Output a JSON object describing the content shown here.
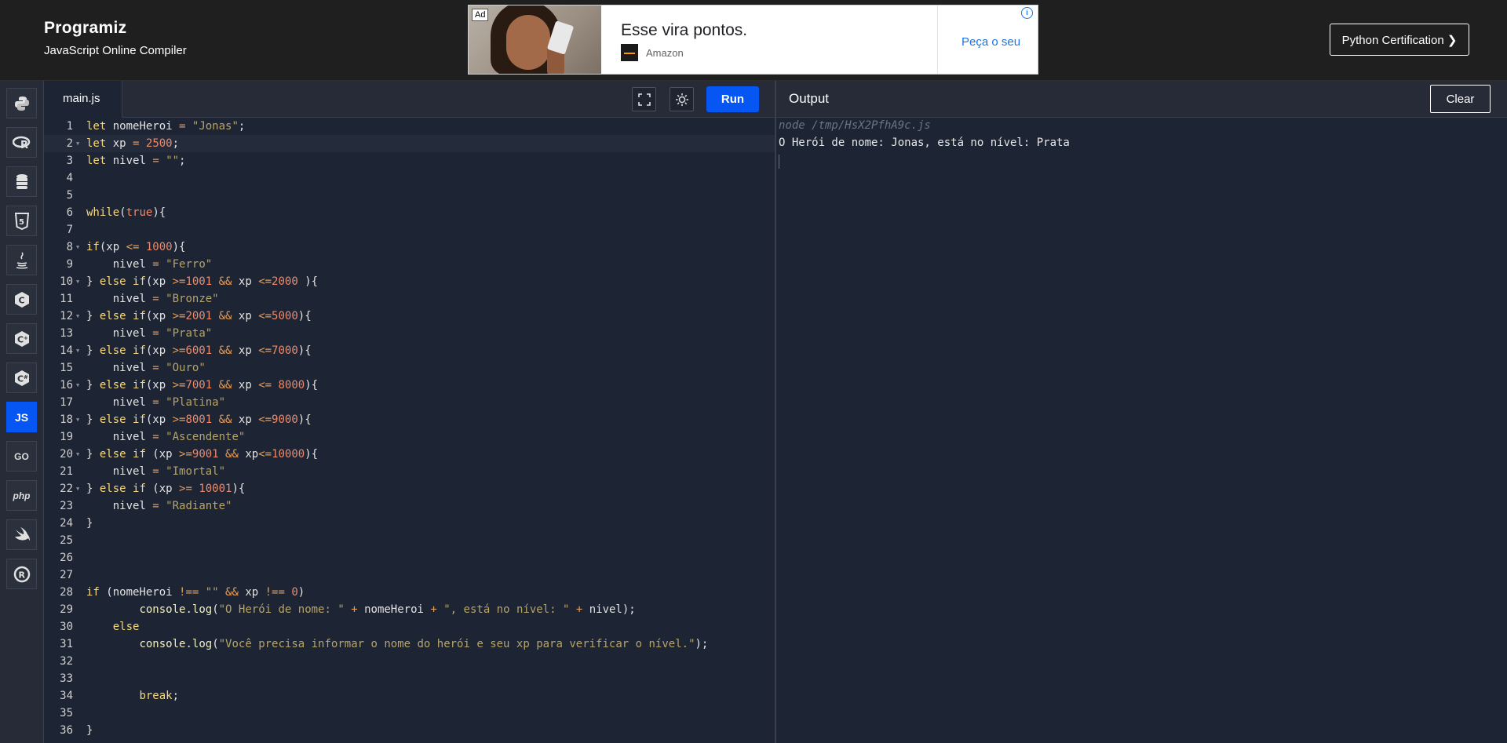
{
  "header": {
    "logo_text": "Programiz",
    "subtitle": "JavaScript Online Compiler",
    "cert_button": "Python Certification ❯"
  },
  "ad": {
    "badge": "Ad",
    "headline": "Esse vira pontos.",
    "source": "Amazon",
    "cta": "Peça o seu",
    "info_icon": "info-icon"
  },
  "sidebar": {
    "items": [
      {
        "name": "python",
        "icon": "python-icon",
        "label": ""
      },
      {
        "name": "r",
        "icon": "r-icon",
        "label": ""
      },
      {
        "name": "sql",
        "icon": "database-icon",
        "label": ""
      },
      {
        "name": "html",
        "icon": "html5-icon",
        "label": ""
      },
      {
        "name": "java",
        "icon": "java-icon",
        "label": ""
      },
      {
        "name": "c",
        "icon": "c-icon",
        "label": ""
      },
      {
        "name": "cpp",
        "icon": "cpp-icon",
        "label": ""
      },
      {
        "name": "csharp",
        "icon": "csharp-icon",
        "label": ""
      },
      {
        "name": "javascript",
        "icon": "js-icon",
        "label": "JS",
        "active": true
      },
      {
        "name": "go",
        "icon": "go-icon",
        "label": "GO"
      },
      {
        "name": "php",
        "icon": "php-icon",
        "label": "php"
      },
      {
        "name": "swift",
        "icon": "swift-icon",
        "label": ""
      },
      {
        "name": "rust",
        "icon": "rust-icon",
        "label": ""
      }
    ]
  },
  "editor": {
    "file_tab": "main.js",
    "run_label": "Run",
    "fullscreen_icon": "fullscreen-icon",
    "theme_icon": "sun-icon",
    "current_line": 2,
    "lines": [
      "let nomeHeroi = \"Jonas\";",
      "let xp = 2500;",
      "let nivel = \"\";",
      "",
      "",
      "while(true){",
      "",
      "if(xp <= 1000){",
      "    nivel = \"Ferro\"",
      "} else if(xp >=1001 && xp <=2000 ){",
      "    nivel = \"Bronze\"",
      "} else if(xp >=2001 && xp <=5000){",
      "    nivel = \"Prata\"",
      "} else if(xp >=6001 && xp <=7000){",
      "    nivel = \"Ouro\"",
      "} else if(xp >=7001 && xp <= 8000){",
      "    nivel = \"Platina\"",
      "} else if(xp >=8001 && xp <=9000){",
      "    nivel = \"Ascendente\"",
      "} else if (xp >=9001 && xp<=10000){",
      "    nivel = \"Imortal\"",
      "} else if (xp >= 10001){",
      "    nivel = \"Radiante\"",
      "}",
      "",
      "",
      "",
      "if (nomeHeroi !== \"\" && xp !== 0)",
      "        console.log(\"O Herói de nome: \" + nomeHeroi + \", está no nível: \" + nivel);",
      "    else",
      "        console.log(\"Você precisa informar o nome do herói e seu xp para verificar o nível.\");",
      "",
      "",
      "        break;",
      "",
      "}"
    ],
    "fold_lines": [
      2,
      8,
      10,
      12,
      14,
      16,
      18,
      20,
      22
    ]
  },
  "output": {
    "title": "Output",
    "clear_label": "Clear",
    "command": "node /tmp/HsX2PfhA9c.js",
    "result": "O Herói de nome: Jonas, está no nível: Prata"
  }
}
